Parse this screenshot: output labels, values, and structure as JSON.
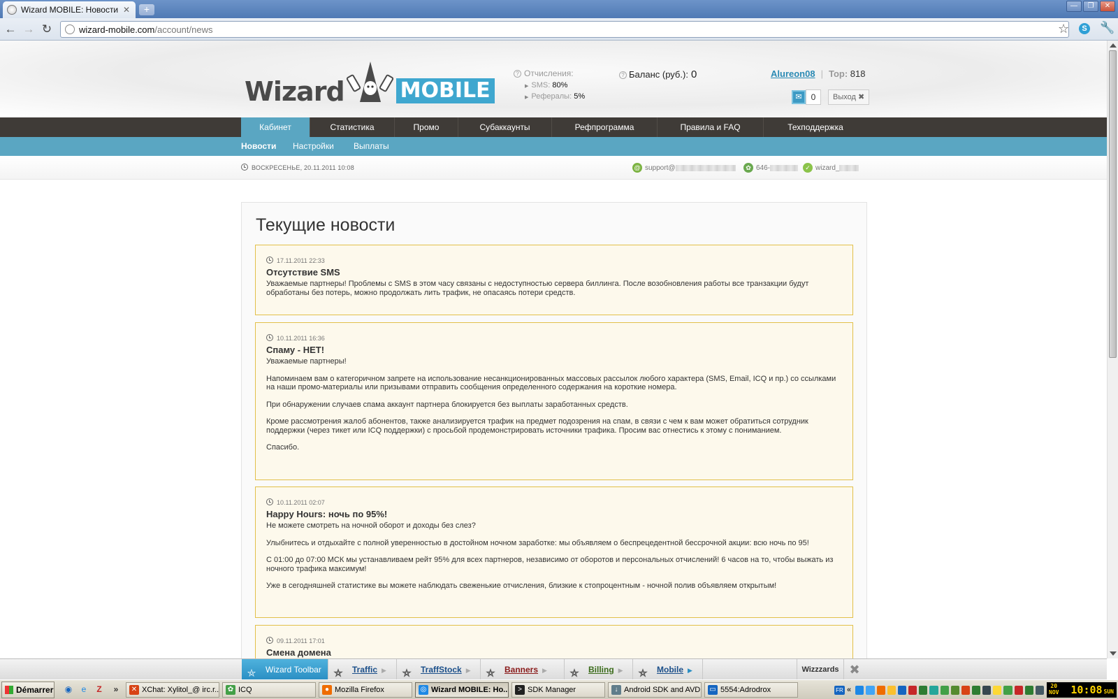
{
  "browser": {
    "tab_title": "Wizard MOBILE: Новости",
    "new_tab": "+",
    "url_host": "wizard-mobile.com",
    "url_path": "/account/news"
  },
  "header": {
    "logo_word": "Wizard",
    "logo_badge": "MOBILE",
    "deductions_label": "Отчисления:",
    "sms_label": "SMS:",
    "sms_value": "80%",
    "referrals_label": "Рефералы:",
    "referrals_value": "5%",
    "balance_label": "Баланс (руб.):",
    "balance_value": "0",
    "username": "Alureon08",
    "sep": "|",
    "top_label": "Top:",
    "top_value": "818",
    "mail_count": "0",
    "logout_label": "Выход ✖"
  },
  "main_nav": [
    "Кабинет",
    "Статистика",
    "Промо",
    "Субаккаунты",
    "Рефпрограмма",
    "Правила и FAQ",
    "Техподдержка"
  ],
  "sub_nav": [
    "Новости",
    "Настройки",
    "Выплаты"
  ],
  "infobar": {
    "date": "ВОСКРЕСЕНЬЕ, 20.11.2011 10:08",
    "email": "support@",
    "icq": "646-",
    "skype": "wizard_"
  },
  "content": {
    "title": "Текущие новости",
    "news": [
      {
        "date": "17.11.2011 22:33",
        "title": "Отсутствие SMS",
        "paragraphs": [
          "Уважаемые партнеры! Проблемы с SMS в этом часу связаны с недоступностью сервера биллинга. После возобновления работы все транзакции будут обработаны без потерь, можно продолжать лить трафик, не опасаясь потери средств."
        ]
      },
      {
        "date": "10.11.2011 16:36",
        "title": "Спаму - НЕТ!",
        "paragraphs": [
          "Уважаемые партнеры!",
          "Напоминаем вам о категоричном запрете на использование несанкционированных массовых рассылок любого характера (SMS, Email, ICQ и пр.) со ссылками на наши промо-материалы или призывами отправить сообщения определенного содержания на короткие номера.",
          "При обнаружении случаев спама аккаунт партнера блокируется без выплаты заработанных средств.",
          "Кроме рассмотрения жалоб абонентов, также анализируется трафик на предмет подозрения на спам, в связи с чем к вам может обратиться сотрудник поддержки (через тикет или ICQ поддержки) с просьбой продемонстрировать источники трафика. Просим вас отнестись к этому с пониманием.",
          "Спасибо."
        ]
      },
      {
        "date": "10.11.2011 02:07",
        "title": "Happy Hours: ночь по 95%!",
        "paragraphs": [
          "Не можете смотреть на ночной оборот и доходы без слез?",
          "Улыбнитесь и отдыхайте с полной уверенностью в достойном ночном заработке: мы объявляем о беспрецедентной бессрочной акции: всю ночь по 95!",
          "С 01:00 до 07:00 МСК мы устанавливаем рейт 95% для всех партнеров, независимо от оборотов и персональных отчислений! 6 часов на то, чтобы выжать из ночного трафика максимум!",
          "Уже в сегодняшней статистике вы можете наблюдать свеженькие отчисления, близкие к стопроцентным - ночной полив объявляем открытым!"
        ]
      },
      {
        "date": "09.11.2011 17:01",
        "title": "Смена домена",
        "paragraphs": []
      }
    ]
  },
  "wizard_toolbar": {
    "main": "Wizard Toolbar",
    "items": [
      "Traffic",
      "TraffStock",
      "Banners",
      "Billing",
      "Mobile"
    ],
    "right": "Wizzzards"
  },
  "taskbar": {
    "start": "Démarrer",
    "more": "»",
    "buttons": [
      "XChat: Xylitol_@ irc.r...",
      "ICQ",
      "Mozilla Firefox",
      "Wizard MOBILE: Но...",
      "SDK Manager",
      "Android SDK and AVD ...",
      "5554:Adrodrox"
    ],
    "lang": "FR",
    "clock": "10:08",
    "clock_day": "20",
    "clock_month": "NOV",
    "clock_weekday": "SUN"
  },
  "colors": {
    "accent": "#5aa6c2",
    "nav_dark": "#3f3b37",
    "news_border": "#e2c04a",
    "news_bg": "#fdf9ec",
    "link": "#2a8ab4"
  }
}
